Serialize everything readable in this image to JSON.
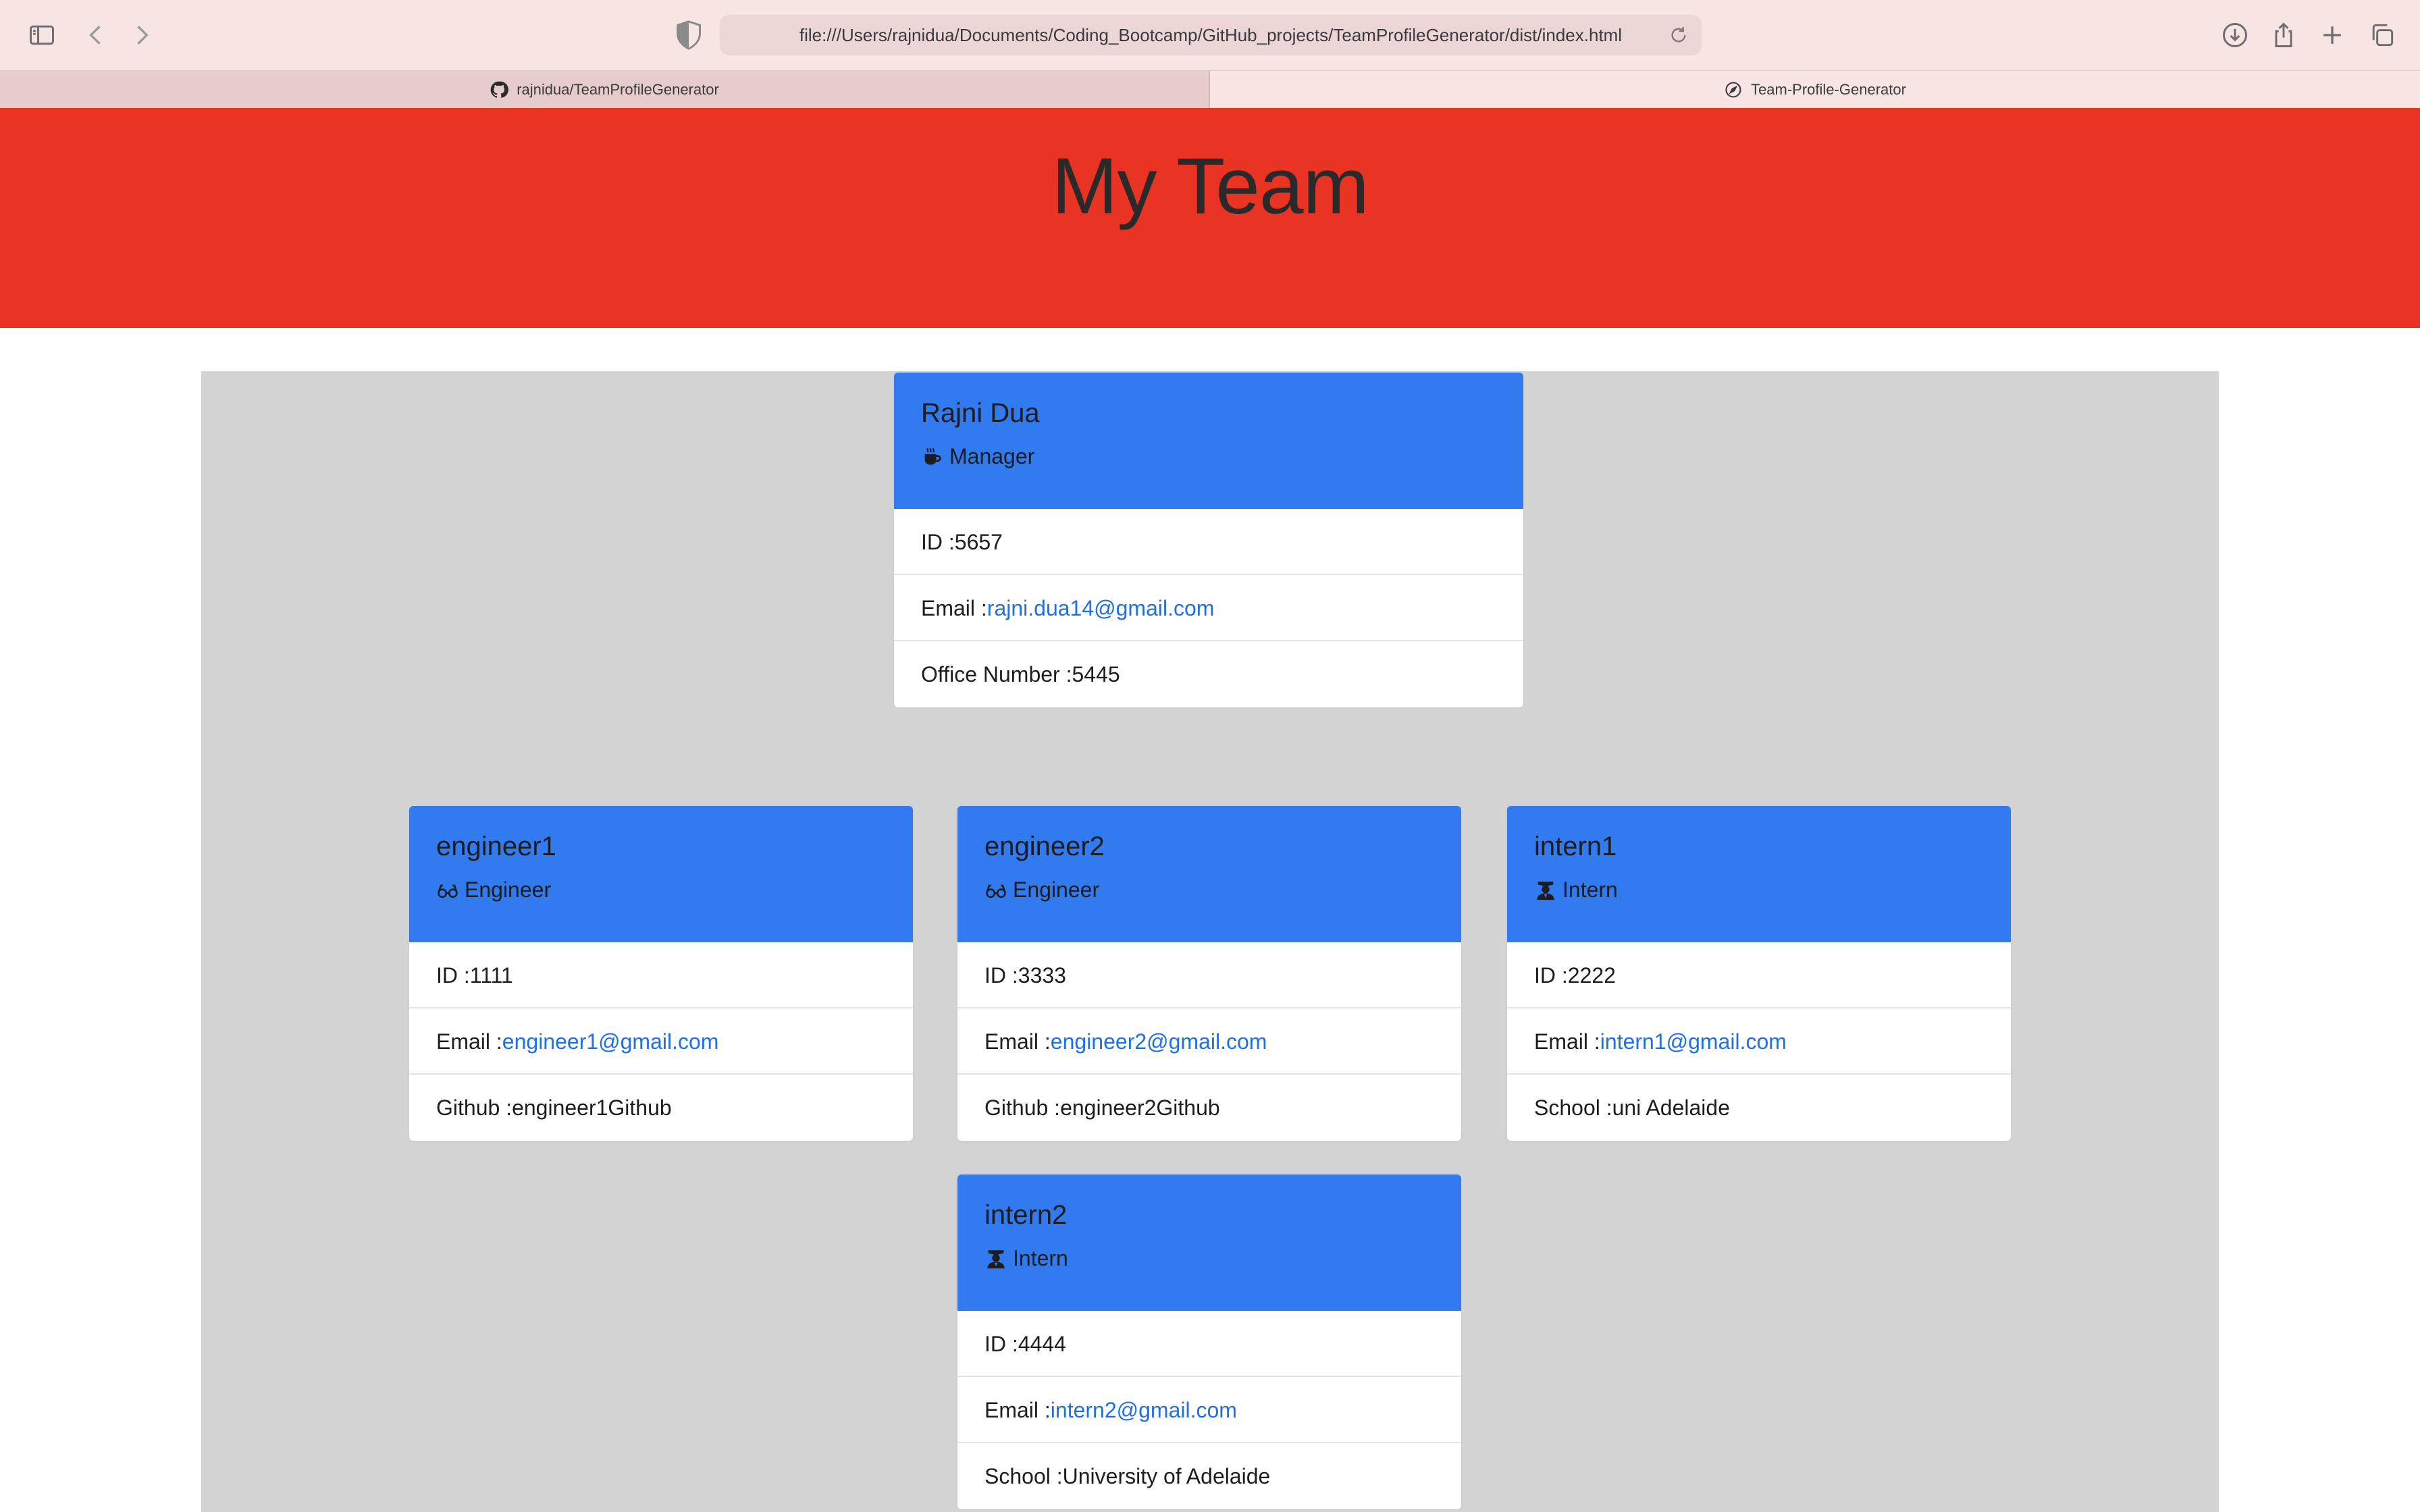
{
  "browser": {
    "url": "file:///Users/rajnidua/Documents/Coding_Bootcamp/GitHub_projects/TeamProfileGenerator/dist/index.html",
    "tabs": [
      {
        "label": "rajnidua/TeamProfileGenerator",
        "icon": "github-icon",
        "active": false
      },
      {
        "label": "Team-Profile-Generator",
        "icon": "compass-icon",
        "active": true
      }
    ],
    "colors": {
      "chrome": "#f7e5e4"
    }
  },
  "page": {
    "title": "My Team",
    "colors": {
      "header": "#e93323",
      "background": "#d3d3d3",
      "card_header": "#317aef",
      "link": "#1f6fe5"
    }
  },
  "team": {
    "manager": {
      "name": "Rajni Dua",
      "role": "Manager",
      "role_icon": "coffee-icon",
      "id": "ID :5657",
      "email_label": "Email :",
      "email": "rajni.dua14@gmail.com",
      "extra": "Office Number :5445"
    },
    "engineer1": {
      "name": "engineer1",
      "role": "Engineer",
      "role_icon": "glasses-icon",
      "id": "ID :1111",
      "email_label": "Email :",
      "email": "engineer1@gmail.com",
      "extra": "Github :engineer1Github"
    },
    "engineer2": {
      "name": "engineer2",
      "role": "Engineer",
      "role_icon": "glasses-icon",
      "id": "ID :3333",
      "email_label": "Email :",
      "email": "engineer2@gmail.com",
      "extra": "Github :engineer2Github"
    },
    "intern1": {
      "name": "intern1",
      "role": "Intern",
      "role_icon": "graduate-icon",
      "id": "ID :2222",
      "email_label": "Email :",
      "email": "intern1@gmail.com",
      "extra": "School :uni Adelaide"
    },
    "intern2": {
      "name": "intern2",
      "role": "Intern",
      "role_icon": "graduate-icon",
      "id": "ID :4444",
      "email_label": "Email :",
      "email": "intern2@gmail.com",
      "extra": "School :University of Adelaide"
    }
  }
}
